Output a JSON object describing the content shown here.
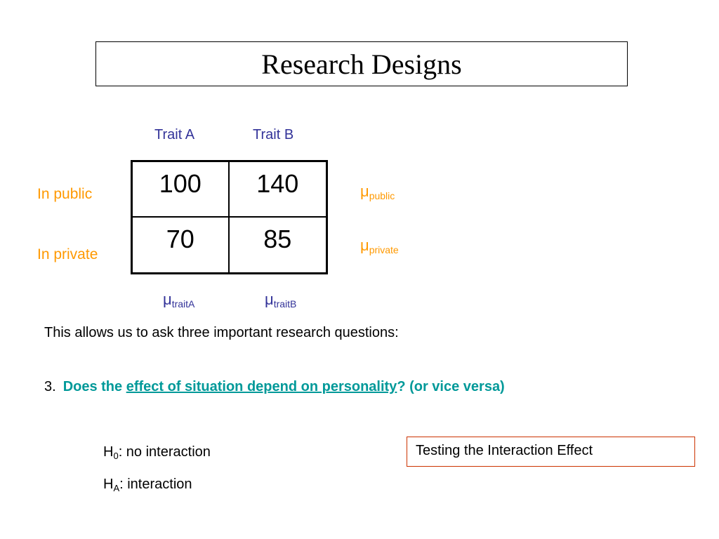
{
  "title": "Research Designs",
  "columns": [
    "Trait A",
    "Trait B"
  ],
  "rows": [
    "In public",
    "In private"
  ],
  "cells": [
    [
      "100",
      "140"
    ],
    [
      "70",
      "85"
    ]
  ],
  "row_means": [
    {
      "symbol": "μ",
      "sub": "public"
    },
    {
      "symbol": "μ",
      "sub": "private"
    }
  ],
  "col_means": [
    {
      "symbol": "μ",
      "sub": "traitA"
    },
    {
      "symbol": "μ",
      "sub": "traitB"
    }
  ],
  "intro": "This allows us to ask three important research questions:",
  "question": {
    "number": "3.",
    "before": "Does the ",
    "underlined": "effect of situation depend on personality",
    "after": "? (or vice versa)"
  },
  "hypotheses": [
    {
      "letter": "H",
      "sub": "0",
      "text": ":  no interaction"
    },
    {
      "letter": "H",
      "sub": "A",
      "text": ":  interaction"
    }
  ],
  "note_box": "Testing the Interaction Effect",
  "colors": {
    "blue": "#333399",
    "orange": "#ff9900",
    "teal": "#009999",
    "note_border": "#cc3300"
  }
}
